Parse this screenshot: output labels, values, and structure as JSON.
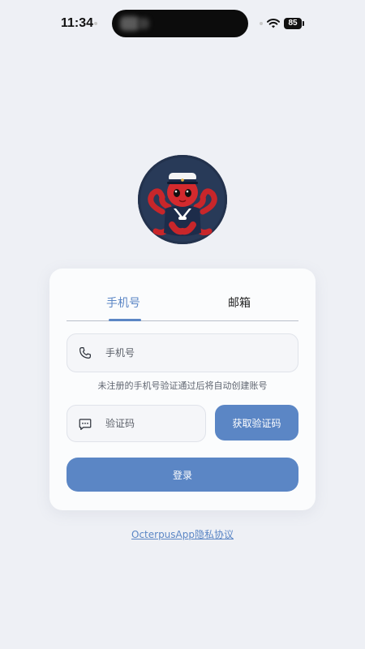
{
  "status_bar": {
    "time": "11:34",
    "battery": "85"
  },
  "login": {
    "tabs": [
      {
        "label": "手机号",
        "active": true
      },
      {
        "label": "邮箱",
        "active": false
      }
    ],
    "phone_placeholder": "手机号",
    "hint": "未注册的手机号验证通过后将自动创建账号",
    "code_placeholder": "验证码",
    "get_code_label": "获取验证码",
    "login_label": "登录"
  },
  "footer": {
    "privacy_link": "OcterpusApp隐私协议"
  },
  "colors": {
    "accent": "#5b86c5",
    "background": "#eef0f5",
    "card": "#fbfcfd"
  },
  "icons": {
    "phone": "phone-icon",
    "message": "message-icon",
    "wifi": "wifi-icon"
  }
}
